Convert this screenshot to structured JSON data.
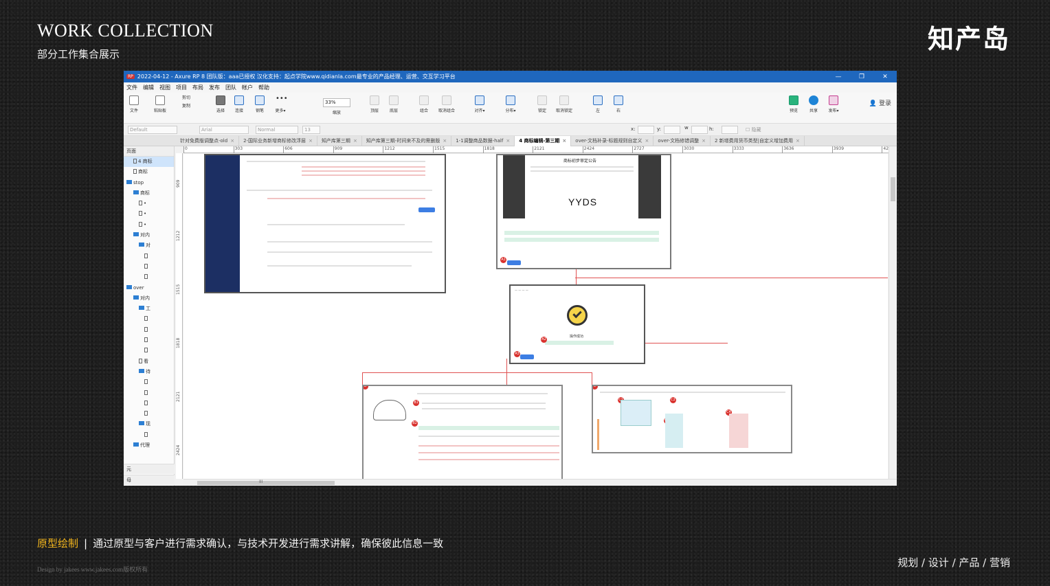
{
  "slide": {
    "title": "WORK COLLECTION",
    "subtitle": "部分工作集合展示",
    "brand": "知产岛",
    "caption_highlight": "原型绘制",
    "caption_sep": "|",
    "caption_text": "通过原型与客户进行需求确认，与技术开发进行需求讲解，确保彼此信息一致",
    "footer_credit": "Design by jakees   www.jakees.com版权所有",
    "footer_tags": "规划 / 设计 / 产品 / 营销"
  },
  "app": {
    "title": "2022-04-12 - Axure RP 8 团队版：aaa已授权 汉化支持：起点学院www.qidianla.com最专业的产品经理、运营、交互学习平台",
    "rp_badge": "RP",
    "window_controls": [
      "—",
      "❐",
      "✕"
    ],
    "menu": [
      "文件",
      "编辑",
      "视图",
      "项目",
      "布局",
      "发布",
      "团队",
      "帐户",
      "帮助"
    ],
    "toolbar": {
      "file": "文件",
      "clipboard": "粘贴板",
      "cut": "剪切",
      "copy": "复制",
      "select": "选择",
      "connect": "连接",
      "pen": "钢笔",
      "more": "更多▾",
      "zoom": "33%",
      "zoom_label": "缩放",
      "top": "顶层",
      "bottom": "底层",
      "group": "组合",
      "ungroup": "取消组合",
      "align": "对齐▾",
      "distribute": "分布▾",
      "lock": "锁定",
      "unlock": "取消锁定",
      "left": "左",
      "right": "右",
      "preview": "预览",
      "share": "共享",
      "publish": "发布▾",
      "login": "登录"
    },
    "format": {
      "style": "Default",
      "font": "Arial",
      "weight": "Normal",
      "size": "13",
      "x_label": "x:",
      "y_label": "y:",
      "w_label": "w",
      "h_label": "h:",
      "hidden": "隐藏"
    },
    "tabs": [
      {
        "label": "针对免费版调整点-old",
        "active": false
      },
      {
        "label": "2-国际业务新增商标修改浮层",
        "active": false
      },
      {
        "label": "知产库第三期",
        "active": false
      },
      {
        "label": "知产库第三期-时间来不及的需删版",
        "active": false
      },
      {
        "label": "1-1调整商品数据-half",
        "active": false
      },
      {
        "label": "4 商标编辑-第三期",
        "active": true
      },
      {
        "label": "over-文档补录-标题规则自定义",
        "active": false
      },
      {
        "label": "over-文档修错调整",
        "active": false
      },
      {
        "label": "2 新增费用货币类型|自定义增加费用",
        "active": false
      }
    ],
    "tab_close": "×",
    "left_panel": {
      "header": "页面",
      "tree": [
        {
          "label": "4 商标",
          "type": "page",
          "selected": true
        },
        {
          "label": "商标",
          "type": "page"
        },
        {
          "label": "stop",
          "type": "folder"
        },
        {
          "label": "商标",
          "type": "folder"
        },
        {
          "label": "•",
          "type": "page"
        },
        {
          "label": "•",
          "type": "page"
        },
        {
          "label": "•",
          "type": "page"
        },
        {
          "label": "对内",
          "type": "folder"
        },
        {
          "label": "对",
          "type": "folder"
        },
        {
          "label": "",
          "type": "page"
        },
        {
          "label": "",
          "type": "page"
        },
        {
          "label": "",
          "type": "page"
        },
        {
          "label": "over",
          "type": "folder"
        },
        {
          "label": "对内",
          "type": "folder"
        },
        {
          "label": "工",
          "type": "folder"
        },
        {
          "label": "",
          "type": "page"
        },
        {
          "label": "",
          "type": "page"
        },
        {
          "label": "",
          "type": "page"
        },
        {
          "label": "",
          "type": "page"
        },
        {
          "label": "看",
          "type": "page"
        },
        {
          "label": "待",
          "type": "folder"
        },
        {
          "label": "",
          "type": "page"
        },
        {
          "label": "",
          "type": "page"
        },
        {
          "label": "",
          "type": "page"
        },
        {
          "label": "",
          "type": "page"
        },
        {
          "label": "现",
          "type": "folder"
        },
        {
          "label": "",
          "type": "page"
        },
        {
          "label": "代理",
          "type": "folder"
        }
      ],
      "footer_1": "元",
      "footer_2": "母"
    },
    "ruler_top": [
      "0",
      "303",
      "606",
      "909",
      "1212",
      "1515",
      "1818",
      "2121",
      "2424",
      "2727",
      "3030",
      "3333",
      "3636",
      "3939",
      "424"
    ],
    "ruler_left": [
      "909",
      "1212",
      "1515",
      "1818",
      "2121",
      "2424"
    ],
    "canvas": {
      "yyds": "YYDS",
      "notice_title": "商标初步审定公告",
      "success_text": "操作成功",
      "dots": [
        "A1",
        "A2",
        "A3",
        "B",
        "B1",
        "B2",
        "C",
        "C1",
        "C2",
        "C3",
        "C4"
      ]
    },
    "scroll_mark": "III"
  },
  "colors": {
    "accent": "#f2b51d",
    "titlebar": "#1f67bd",
    "navy": "#1c2f63",
    "connector": "#e05151"
  }
}
